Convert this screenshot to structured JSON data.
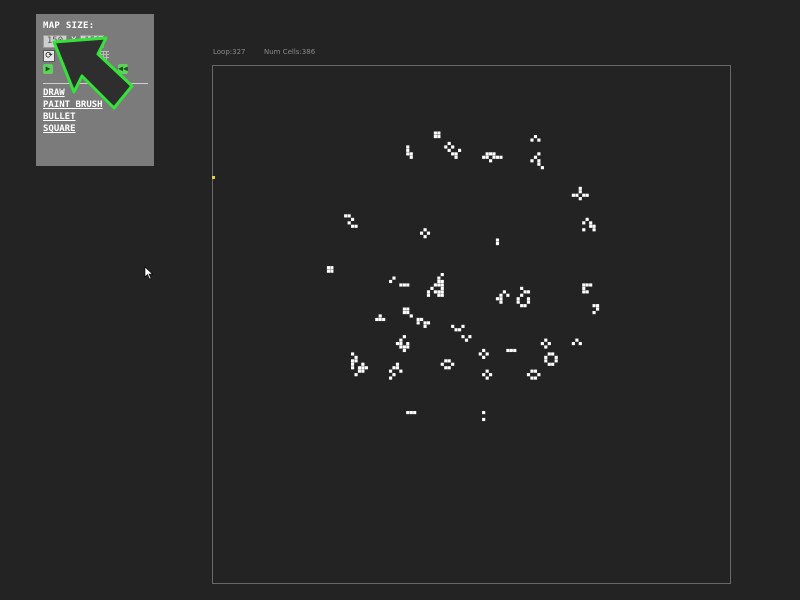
{
  "panel": {
    "title": "MAP SIZE:",
    "width_value": "150",
    "separator": "X",
    "height_value": "150",
    "tools": [
      "DRAW",
      "PAINT BRUSH",
      "BULLET",
      "SQUARE"
    ]
  },
  "status": {
    "loop_label": "Loop:327",
    "cells_label": "Num Cells:386"
  },
  "icons": {
    "refresh": "refresh-icon",
    "grid": "grid-icon",
    "play": "play-icon",
    "rewind": "rewind-icon"
  },
  "colors": {
    "background": "#232323",
    "panel": "#7b7b7b",
    "cell": "#ffffff",
    "accent_green": "#35e23a",
    "board_border": "#686868",
    "marker": "#e8d23c"
  }
}
